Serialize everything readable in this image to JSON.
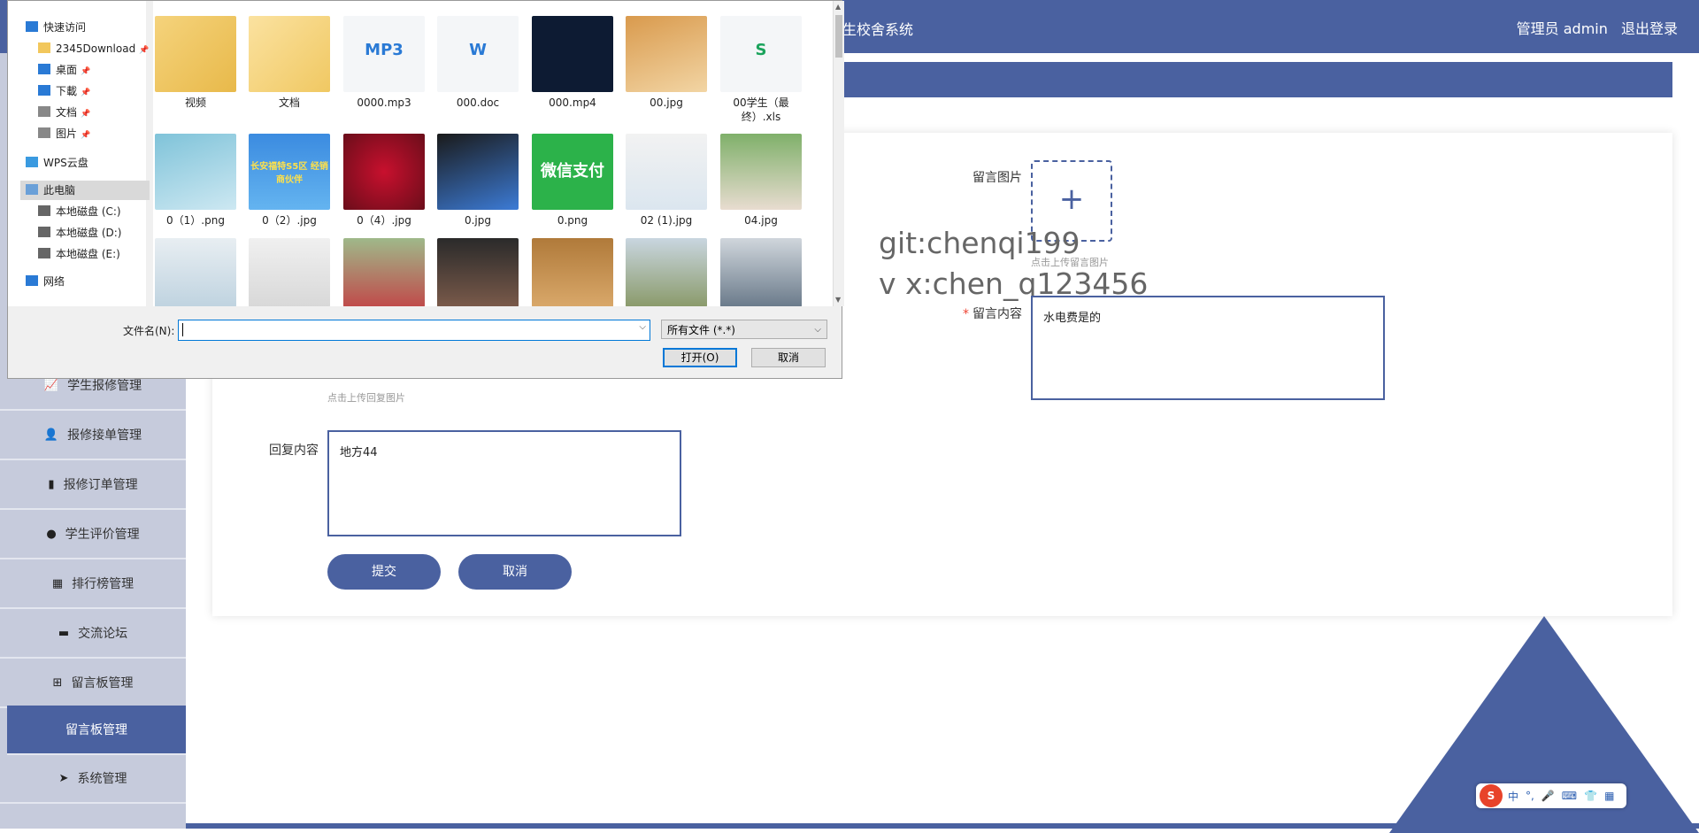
{
  "header": {
    "system_title": "生校舍系统",
    "user_label": "管理员 admin",
    "logout_label": "退出登录"
  },
  "sidebar": {
    "items": [
      {
        "label": "学生报修管理",
        "icon": "chart-icon"
      },
      {
        "label": "报修接单管理",
        "icon": "user-icon"
      },
      {
        "label": "报修订单管理",
        "icon": "bar-chart-icon"
      },
      {
        "label": "学生评价管理",
        "icon": "lightbulb-icon"
      },
      {
        "label": "排行榜管理",
        "icon": "grid-icon"
      },
      {
        "label": "交流论坛",
        "icon": "monitor-icon"
      },
      {
        "label": "留言板管理",
        "icon": "apps-icon"
      },
      {
        "label": "留言板管理",
        "icon": "none",
        "active": true
      },
      {
        "label": "系统管理",
        "icon": "send-icon"
      }
    ]
  },
  "form": {
    "image_label": "留言图片",
    "image_plus": "+",
    "image_hint": "点击上传留言图片",
    "content_label": "留言内容",
    "content_value": "水电费是的",
    "reply_image_hint": "点击上传回复图片",
    "reply_label": "回复内容",
    "reply_value": "地方44",
    "submit_label": "提交",
    "cancel_label": "取消"
  },
  "watermark": {
    "line1": "git:chenqi199",
    "line2": "v x:chen_q123456"
  },
  "ime": {
    "logo": "S",
    "items": [
      "中",
      "°,",
      "🎤",
      "⌨",
      "👕",
      "▦"
    ]
  },
  "dialog": {
    "tree": [
      {
        "label": "快速访问",
        "icon": "star-icon",
        "pin": false
      },
      {
        "label": "2345Download",
        "icon": "folder-icon",
        "pin": true
      },
      {
        "label": "桌面",
        "icon": "desktop-icon",
        "pin": true
      },
      {
        "label": "下載",
        "icon": "download-icon",
        "pin": true
      },
      {
        "label": "文档",
        "icon": "document-icon",
        "pin": true
      },
      {
        "label": "图片",
        "icon": "picture-icon",
        "pin": true
      },
      {
        "label": "WPS云盘",
        "icon": "cloud-icon",
        "pin": false
      },
      {
        "label": "此电脑",
        "icon": "computer-icon",
        "pin": false,
        "selected": true
      },
      {
        "label": "本地磁盘 (C:)",
        "icon": "drive-icon",
        "pin": false
      },
      {
        "label": "本地磁盘 (D:)",
        "icon": "drive-icon",
        "pin": false
      },
      {
        "label": "本地磁盘 (E:)",
        "icon": "drive-icon",
        "pin": false
      },
      {
        "label": "网络",
        "icon": "network-icon",
        "pin": false
      }
    ],
    "files_row1": [
      {
        "name": "视频",
        "kind": "video-folder"
      },
      {
        "name": "文档",
        "kind": "folder"
      },
      {
        "name": "0000.mp3",
        "kind": "mp3",
        "badge": "MP3"
      },
      {
        "name": "000.doc",
        "kind": "doc",
        "badge": "W"
      },
      {
        "name": "000.mp4",
        "kind": "mp4"
      },
      {
        "name": "00.jpg",
        "kind": "photo-dog"
      },
      {
        "name": "00学生（最终）.xls",
        "kind": "xls",
        "badge": "S"
      }
    ],
    "files_row2": [
      {
        "name": "0（1）.png",
        "kind": "photo"
      },
      {
        "name": "0（2）.jpg",
        "kind": "banner",
        "badge": "长安福特S5区 经销商伙伴"
      },
      {
        "name": "0（4）.jpg",
        "kind": "photo-roses"
      },
      {
        "name": "0.jpg",
        "kind": "photo-figure"
      },
      {
        "name": "0.png",
        "kind": "qr",
        "badge": "微信支付"
      },
      {
        "name": "02 (1).jpg",
        "kind": "photo-doctor"
      },
      {
        "name": "04.jpg",
        "kind": "photo-girl"
      }
    ],
    "files_row3_count": 7,
    "filename_label": "文件名(N):",
    "filename_value": "",
    "filter_value": "所有文件 (*.*)",
    "open_label": "打开(O)",
    "cancel_label": "取消"
  },
  "colors": {
    "brand": "#4a61a0",
    "sidebar_bg": "#c6cbdc"
  }
}
